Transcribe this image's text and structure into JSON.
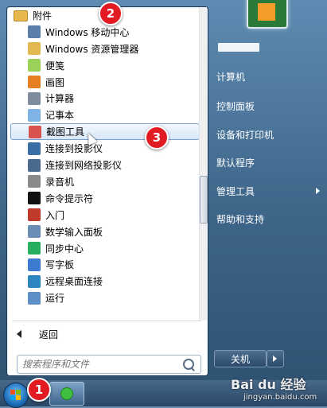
{
  "left_panel": {
    "programs": [
      {
        "name": "folder-accessories",
        "label": "附件",
        "icon": "folder-icon",
        "sub": false,
        "highlight": false
      },
      {
        "name": "windows-mobility-center",
        "label": "Windows 移动中心",
        "icon": "mobility-center-icon",
        "sub": true,
        "highlight": false
      },
      {
        "name": "windows-explorer",
        "label": "Windows 资源管理器",
        "icon": "folder-explorer-icon",
        "sub": true,
        "highlight": false
      },
      {
        "name": "sticky-notes",
        "label": "便笺",
        "icon": "sticky-note-icon",
        "sub": true,
        "highlight": false
      },
      {
        "name": "paint",
        "label": "画图",
        "icon": "paint-icon",
        "sub": true,
        "highlight": false
      },
      {
        "name": "calculator",
        "label": "计算器",
        "icon": "calculator-icon",
        "sub": true,
        "highlight": false
      },
      {
        "name": "notepad",
        "label": "记事本",
        "icon": "notepad-icon",
        "sub": true,
        "highlight": false
      },
      {
        "name": "snipping-tool",
        "label": "截图工具",
        "icon": "scissors-icon",
        "sub": true,
        "highlight": true
      },
      {
        "name": "connect-projector",
        "label": "连接到投影仪",
        "icon": "projector-icon",
        "sub": true,
        "highlight": false
      },
      {
        "name": "connect-network-projector",
        "label": "连接到网络投影仪",
        "icon": "network-projector-icon",
        "sub": true,
        "highlight": false
      },
      {
        "name": "sound-recorder",
        "label": "录音机",
        "icon": "microphone-icon",
        "sub": true,
        "highlight": false
      },
      {
        "name": "command-prompt",
        "label": "命令提示符",
        "icon": "cmd-icon",
        "sub": true,
        "highlight": false
      },
      {
        "name": "getting-started",
        "label": "入门",
        "icon": "getting-started-icon",
        "sub": true,
        "highlight": false
      },
      {
        "name": "math-input-panel",
        "label": "数学输入面板",
        "icon": "math-input-icon",
        "sub": true,
        "highlight": false
      },
      {
        "name": "sync-center",
        "label": "同步中心",
        "icon": "sync-icon",
        "sub": true,
        "highlight": false
      },
      {
        "name": "wordpad",
        "label": "写字板",
        "icon": "wordpad-icon",
        "sub": true,
        "highlight": false
      },
      {
        "name": "remote-desktop",
        "label": "远程桌面连接",
        "icon": "remote-desktop-icon",
        "sub": true,
        "highlight": false
      },
      {
        "name": "run",
        "label": "运行",
        "icon": "run-icon",
        "sub": true,
        "highlight": false
      }
    ],
    "back_label": "返回",
    "search_placeholder": "搜索程序和文件"
  },
  "right_panel": {
    "items": [
      {
        "name": "computer",
        "label": "计算机",
        "has_arrow": false
      },
      {
        "name": "control-panel",
        "label": "控制面板",
        "has_arrow": false
      },
      {
        "name": "devices-printers",
        "label": "设备和打印机",
        "has_arrow": false
      },
      {
        "name": "default-programs",
        "label": "默认程序",
        "has_arrow": false
      },
      {
        "name": "admin-tools",
        "label": "管理工具",
        "has_arrow": true
      },
      {
        "name": "help-support",
        "label": "帮助和支持",
        "has_arrow": false
      }
    ],
    "shutdown_label": "关机"
  },
  "badges": [
    {
      "name": "step-badge-2",
      "label": "2"
    },
    {
      "name": "step-badge-3",
      "label": "3"
    },
    {
      "name": "step-badge-1",
      "label": "1"
    }
  ],
  "watermark": {
    "brand": "Bai du 经验",
    "url": "jingyan.baidu.com"
  },
  "colors": {
    "badge": "#e21b23",
    "highlight_border": "#7da2ce"
  }
}
